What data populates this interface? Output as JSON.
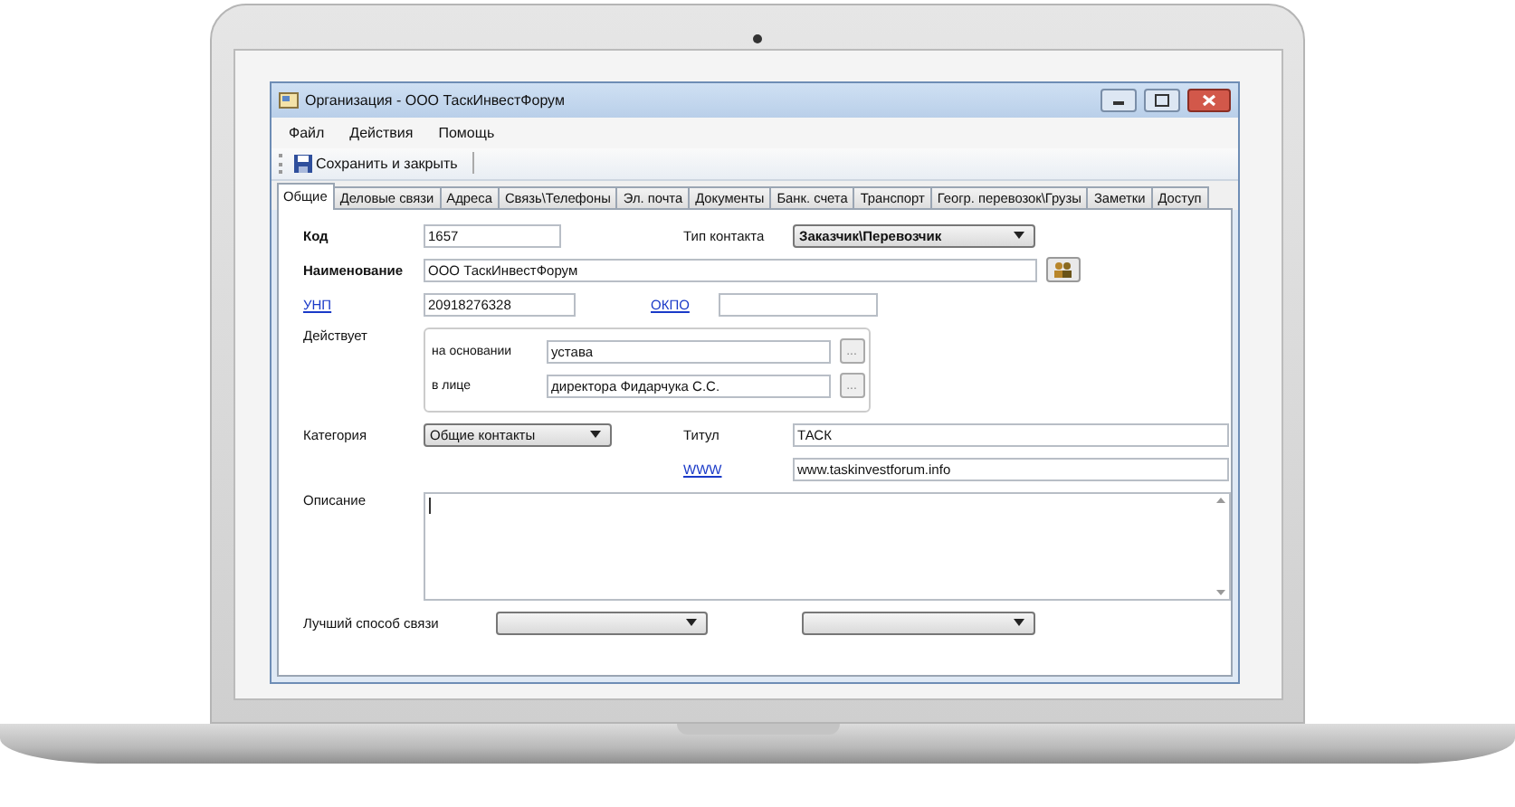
{
  "window": {
    "title": "Организация - ООО ТаскИнвестФорум"
  },
  "menu": [
    {
      "label": "Файл"
    },
    {
      "label": "Действия"
    },
    {
      "label": "Помощь"
    }
  ],
  "toolbar": [
    {
      "label": "Сохранить и закрыть"
    }
  ],
  "tabs": [
    {
      "label": "Общие",
      "selected": true
    },
    {
      "label": "Деловые связи",
      "selected": false
    },
    {
      "label": "Адреса",
      "selected": false
    },
    {
      "label": "Связь\\Телефоны",
      "selected": false
    },
    {
      "label": "Эл. почта",
      "selected": false
    },
    {
      "label": "Документы",
      "selected": false
    },
    {
      "label": "Банк. счета",
      "selected": false
    },
    {
      "label": "Транспорт",
      "selected": false
    },
    {
      "label": "Геогр. перевозок\\Грузы",
      "selected": false
    },
    {
      "label": "Заметки",
      "selected": false
    },
    {
      "label": "Доступ",
      "selected": false
    }
  ],
  "form": {
    "code": {
      "label": "Код",
      "value": "1657"
    },
    "contact_type": {
      "label": "Тип контакта",
      "value": "Заказчик\\Перевозчик"
    },
    "name": {
      "label": "Наименование",
      "value": "ООО ТаскИнвестФорум"
    },
    "unp": {
      "label": "УНП",
      "value": "20918276328"
    },
    "okpo": {
      "label": "ОКПО"
    },
    "acts": {
      "label": "Действует",
      "rows": [
        {
          "label": "на основании",
          "value": "устава",
          "button": "..."
        },
        {
          "label": "в лице",
          "value": "директора Фидарчука С.С.",
          "button": "..."
        }
      ]
    },
    "category": {
      "label": "Категория",
      "value": "Общие контакты"
    },
    "title_field": {
      "label": "Титул",
      "value": "ТАСК"
    },
    "www": {
      "label": "WWW",
      "value": "www.taskinvestforum.info"
    },
    "description": {
      "label": "Описание"
    },
    "best_contact": {
      "label": "Лучший способ связи"
    }
  }
}
